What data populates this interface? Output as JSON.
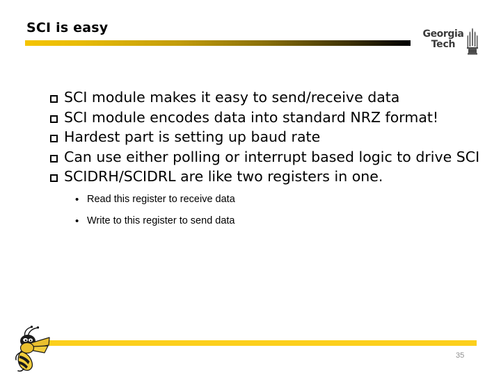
{
  "slide": {
    "title": "SCI is easy",
    "page_number": "35",
    "accent_gold": "#fccf1c",
    "rule_gradient_start": "#f5c400",
    "rule_gradient_end": "#000000",
    "background": "#ffffff",
    "text_color": "#000000",
    "page_number_color": "#8f8f8f"
  },
  "logo": {
    "line1": "Georgia",
    "line2": "Tech",
    "tower_icon": "tech-tower-icon",
    "color": "#3a3a3a"
  },
  "mascot": {
    "icon": "buzz-yellowjacket-mascot",
    "body_color": "#f2c230",
    "stripe_color": "#1a1a1a"
  },
  "bullets": [
    {
      "marker": "hollow-square",
      "text": "SCI module makes it easy to send/receive data",
      "sub_bullets": []
    },
    {
      "marker": "hollow-square",
      "text": "SCI module encodes data into standard NRZ format!",
      "sub_bullets": []
    },
    {
      "marker": "hollow-square",
      "text": "Hardest part is setting up baud rate",
      "sub_bullets": []
    },
    {
      "marker": "hollow-square",
      "text": "Can use either polling or interrupt based logic to drive SCI",
      "sub_bullets": []
    },
    {
      "marker": "hollow-square",
      "text": "SCIDRH/SCIDRL are like two registers in one.",
      "sub_bullets": [
        {
          "marker": "round-bullet",
          "text": "Read this register to receive data"
        },
        {
          "marker": "round-bullet",
          "text": "Write to this register to send data"
        }
      ]
    }
  ]
}
